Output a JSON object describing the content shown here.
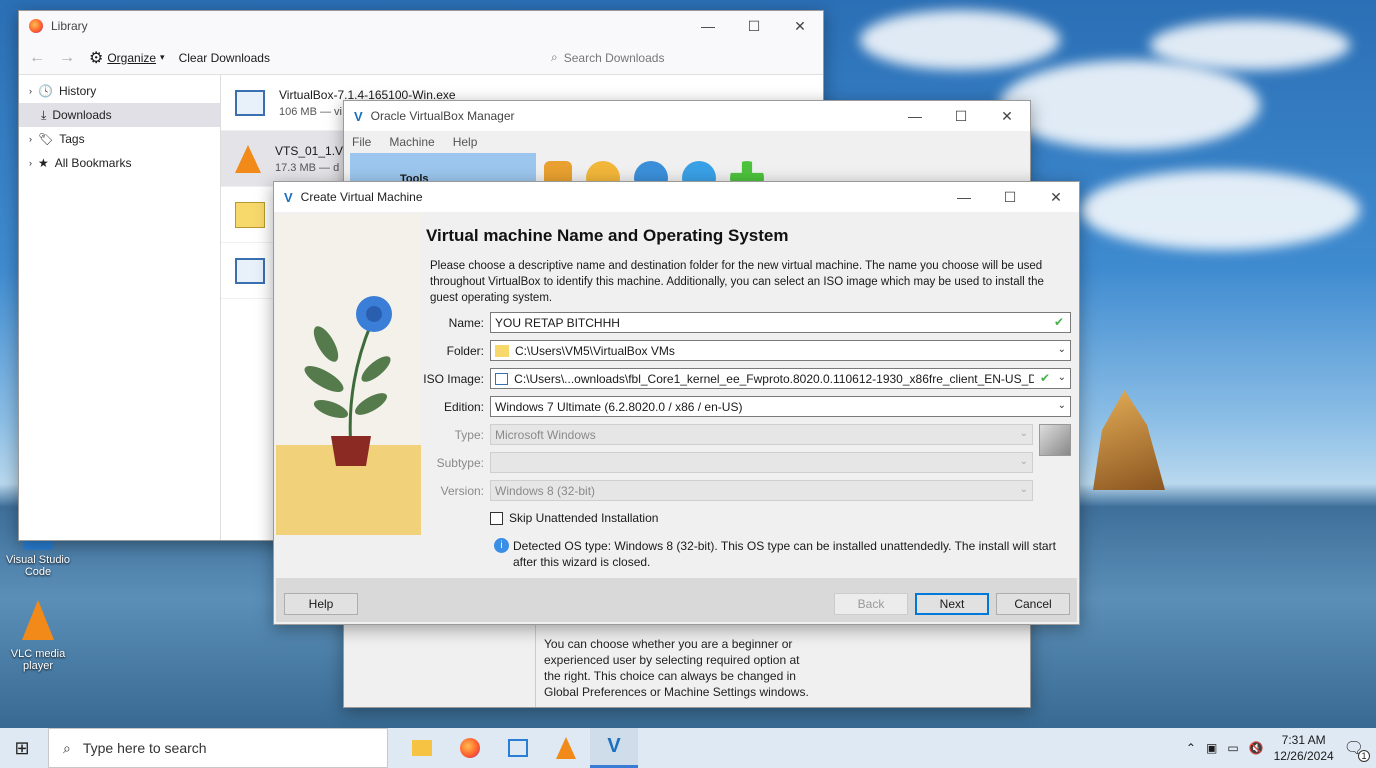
{
  "desktop": {
    "icons": [
      {
        "label": "Visual Studio Code"
      },
      {
        "label": "VLC media player"
      }
    ]
  },
  "library": {
    "title": "Library",
    "organize": "Organize",
    "clear_downloads": "Clear Downloads",
    "search_placeholder": "Search Downloads",
    "sidebar": [
      {
        "label": "History",
        "icon": "clock-icon"
      },
      {
        "label": "Downloads",
        "icon": "download-icon",
        "selected": true
      },
      {
        "label": "Tags",
        "icon": "tag-icon"
      },
      {
        "label": "All Bookmarks",
        "icon": "star-icon"
      }
    ],
    "downloads": [
      {
        "name": "VirtualBox-7.1.4-165100-Win.exe",
        "size": "106 MB — vi"
      },
      {
        "name": "VTS_01_1.VO",
        "size": "17.3 MB — d"
      },
      {
        "name": "",
        "size": ""
      },
      {
        "name": "",
        "size": ""
      }
    ]
  },
  "vbox_manager": {
    "title": "Oracle VirtualBox Manager",
    "menu": [
      "File",
      "Machine",
      "Help"
    ],
    "tools_label": "Tools",
    "help_text": "You can choose whether you are a beginner or experienced user by selecting required option at the right. This choice can always be changed in Global Preferences or Machine Settings windows."
  },
  "dialog": {
    "title": "Create Virtual Machine",
    "heading": "Virtual machine Name and Operating System",
    "description": "Please choose a descriptive name and destination folder for the new virtual machine. The name you choose will be used throughout VirtualBox to identify this machine. Additionally, you can select an ISO image which may be used to install the guest operating system.",
    "fields": {
      "name_label": "Name:",
      "name_value": "YOU RETAP BITCHHH",
      "folder_label": "Folder:",
      "folder_value": "C:\\Users\\VM5\\VirtualBox VMs",
      "iso_label": "ISO Image:",
      "iso_value": "C:\\Users\\...ownloads\\fbl_Core1_kernel_ee_Fwproto.8020.0.110612-1930_x86fre_client_EN-US_DVD.iso",
      "edition_label": "Edition:",
      "edition_value": "Windows 7 Ultimate (6.2.8020.0 / x86 / en-US)",
      "type_label": "Type:",
      "type_value": "Microsoft Windows",
      "subtype_label": "Subtype:",
      "subtype_value": "",
      "version_label": "Version:",
      "version_value": "Windows 8 (32-bit)"
    },
    "skip_unattended": "Skip Unattended Installation",
    "detected_info": "Detected OS type: Windows 8 (32-bit). This OS type can be installed unattendedly. The install will start after this wizard is closed.",
    "buttons": {
      "help": "Help",
      "back": "Back",
      "next": "Next",
      "cancel": "Cancel"
    }
  },
  "taskbar": {
    "search_placeholder": "Type here to search",
    "time": "7:31 AM",
    "date": "12/26/2024",
    "notification_count": "1"
  }
}
